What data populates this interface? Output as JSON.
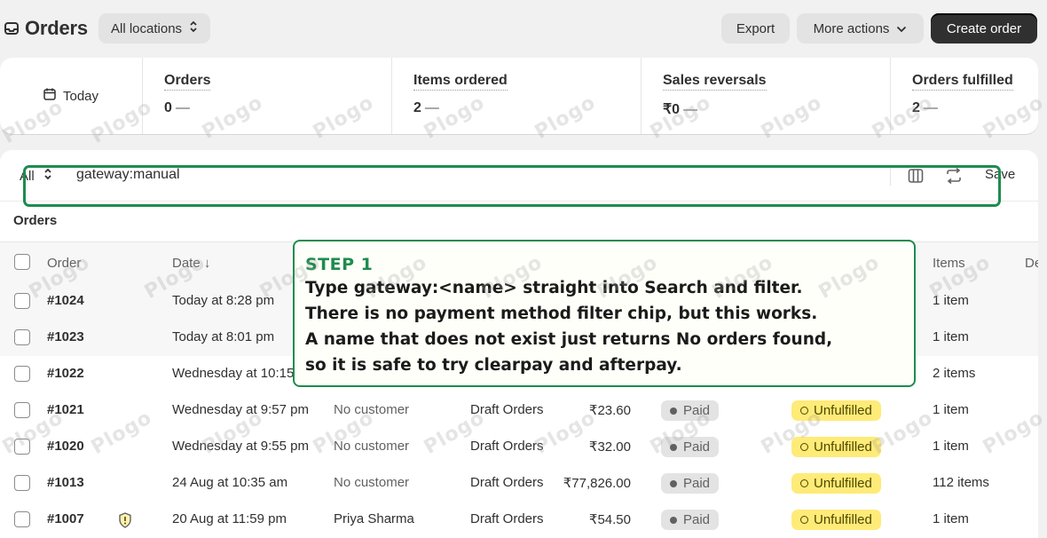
{
  "header": {
    "title": "Orders",
    "location_label": "All locations",
    "export_label": "Export",
    "more_actions_label": "More actions",
    "create_order_label": "Create order"
  },
  "metrics": {
    "date_label": "Today",
    "items": [
      {
        "label": "Orders",
        "value": "0",
        "trend": "—"
      },
      {
        "label": "Items ordered",
        "value": "2",
        "trend": "—"
      },
      {
        "label": "Sales reversals",
        "value": "₹0",
        "trend": "—"
      },
      {
        "label": "Orders fulfilled",
        "value": "2",
        "trend": "—"
      }
    ]
  },
  "filter": {
    "scope_label": "All",
    "query": "gateway:manual",
    "save_label": "Save"
  },
  "view_tab": "Orders",
  "table": {
    "columns": {
      "order": "Order",
      "date": "Date ↓",
      "items": "Items",
      "delivery": "De"
    },
    "rows": [
      {
        "order": "#1024",
        "date": "Today at 8:28 pm",
        "customer": "",
        "channel": "",
        "total": "",
        "payment": "",
        "fulfillment": "",
        "items": "1 item"
      },
      {
        "order": "#1023",
        "date": "Today at 8:01 pm",
        "customer": "",
        "channel": "",
        "total": "",
        "payment": "",
        "fulfillment": "",
        "items": "1 item"
      },
      {
        "order": "#1022",
        "date": "Wednesday at 10:15",
        "customer": "",
        "channel": "",
        "total": "",
        "payment": "",
        "fulfillment": "",
        "items": "2 items"
      },
      {
        "order": "#1021",
        "date": "Wednesday at 9:57 pm",
        "customer": "No customer",
        "channel": "Draft Orders",
        "total": "₹23.60",
        "payment": "Paid",
        "fulfillment": "Unfulfilled",
        "items": "1 item"
      },
      {
        "order": "#1020",
        "date": "Wednesday at 9:55 pm",
        "customer": "No customer",
        "channel": "Draft Orders",
        "total": "₹32.00",
        "payment": "Paid",
        "fulfillment": "Unfulfilled",
        "items": "1 item"
      },
      {
        "order": "#1013",
        "date": "24 Aug at 10:35 am",
        "customer": "No customer",
        "channel": "Draft Orders",
        "total": "₹77,826.00",
        "payment": "Paid",
        "fulfillment": "Unfulfilled",
        "items": "112 items"
      },
      {
        "order": "#1007",
        "date": "20 Aug at 11:59 pm",
        "customer": "Priya Sharma",
        "channel": "Draft Orders",
        "total": "₹54.50",
        "payment": "Paid",
        "fulfillment": "Unfulfilled",
        "items": "1 item"
      }
    ]
  },
  "callout": {
    "step": "STEP 1",
    "lines": [
      "Type gateway:<name> straight into Search and filter.",
      "There is no payment method filter chip, but this works.",
      "A name that does not exist just returns No orders found,",
      "so it is safe to try clearpay and afterpay."
    ]
  },
  "watermark": "Plogo",
  "colors": {
    "accent_green": "#1e8c4e",
    "unfulfilled_yellow": "#ffeb78",
    "paid_grey": "#e3e3e3",
    "primary_dark": "#303030"
  }
}
